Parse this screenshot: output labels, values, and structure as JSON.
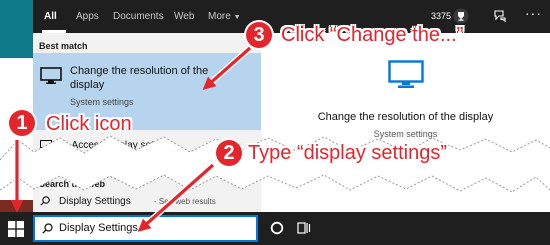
{
  "tabs": [
    "All",
    "Apps",
    "Documents",
    "Web",
    "More"
  ],
  "topbar": {
    "points": "3375",
    "more_options": "···"
  },
  "best_match": {
    "heading": "Best match",
    "title": "Change the resolution of the display",
    "subtitle": "System settings",
    "icon": "monitor-icon"
  },
  "partial_result": {
    "text": "... Access display settings",
    "icon": "settings-icon"
  },
  "web": {
    "heading": "Search the web",
    "query": "Display Settings",
    "suffix": "- See web results"
  },
  "preview": {
    "title": "Change the resolution of the display",
    "subtitle": "System settings",
    "icon": "monitor-icon"
  },
  "taskbar": {
    "search_value": "Display Settings",
    "start_icon": "windows-logo-icon",
    "search_icon": "search-icon",
    "cortana_icon": "cortana-icon",
    "taskview_icon": "task-view-icon"
  },
  "callouts": [
    {
      "number": "1",
      "text": "Click icon"
    },
    {
      "number": "2",
      "text": "Type “display settings”"
    },
    {
      "number": "3",
      "text": "Click “Change the...”"
    }
  ],
  "colors": {
    "accent": "#0078d7",
    "selection": "#b7d4ee",
    "callout": "#e4262c",
    "dark_bar": "#1f1f1f"
  }
}
